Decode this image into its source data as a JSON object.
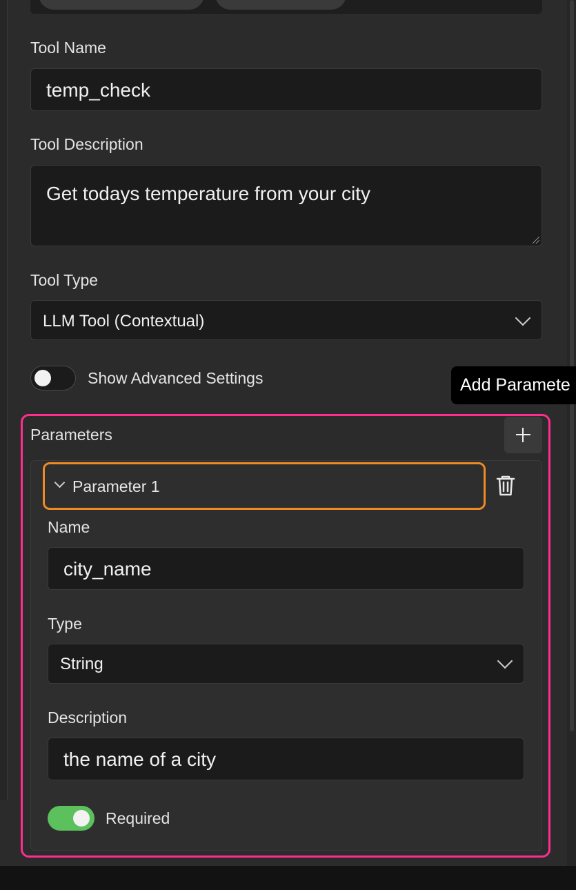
{
  "tool": {
    "name_label": "Tool Name",
    "name_value": "temp_check",
    "description_label": "Tool Description",
    "description_value": "Get todays temperature from your city",
    "type_label": "Tool Type",
    "type_value": "LLM Tool (Contextual)",
    "advanced_label": "Show Advanced Settings",
    "advanced_enabled": false
  },
  "tooltip": {
    "text": "Add Paramete"
  },
  "parameters": {
    "title": "Parameters",
    "add_icon": "plus-icon",
    "items": [
      {
        "header": "Parameter 1",
        "expanded": true,
        "delete_icon": "trash-icon",
        "name_label": "Name",
        "name_value": "city_name",
        "type_label": "Type",
        "type_value": "String",
        "description_label": "Description",
        "description_value": "the name of a city",
        "required_label": "Required",
        "required": true
      }
    ]
  },
  "colors": {
    "highlight_outer": "#ff2d8f",
    "highlight_inner": "#f08a24",
    "toggle_on": "#5cc05c"
  }
}
